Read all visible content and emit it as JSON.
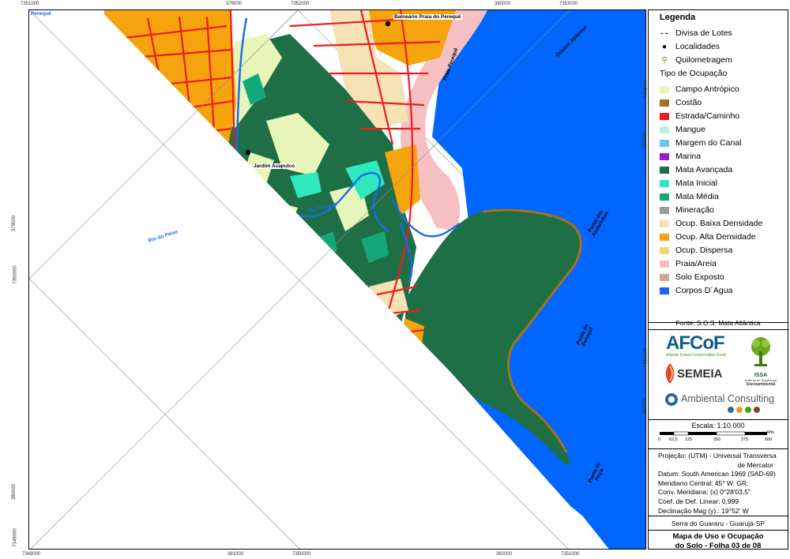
{
  "map": {
    "top_ticks": [
      "7351000",
      "379000",
      "7352000",
      "380000",
      "7353000"
    ],
    "bottom_ticks": [
      "7349000",
      "381000",
      "7350000",
      "382000",
      "7351000"
    ],
    "left_ticks": [
      "379000",
      "7350000",
      "380000",
      "7349000"
    ],
    "right_ticks": [
      "7352000",
      "381000",
      "7350000",
      "382000"
    ],
    "place_labels": {
      "pereque_corner": "Perequê",
      "balneario": "Balneário Praia do Perequê",
      "jardim_acapulco": "Jardim Acapulco",
      "rio_pereque": "Rio Perequê",
      "rio_do_peixe": "Rio do Peixe",
      "praia_pereque": "Praia Perequê",
      "oceano": "Oceano Atlântico",
      "ponta_andorinhas_1": "Ponta das",
      "ponta_andorinhas_2": "Andorinhas",
      "ponta_pereque_1": "Ponta do",
      "ponta_pereque_2": "Perequê",
      "ponta_poco_1": "Ponta do",
      "ponta_poco_2": "Poço"
    }
  },
  "legend": {
    "title": "Legenda",
    "symbols": [
      {
        "label": "Divisa de Lotes",
        "glyph": "- -"
      },
      {
        "label": "Localidades",
        "glyph": "●"
      },
      {
        "label": "Quilometragem",
        "glyph": "⚲"
      }
    ],
    "occupation_heading": "Tipo de Ocupação",
    "classes": [
      {
        "label": "Campo Antrópico",
        "color": "#e8f5b8"
      },
      {
        "label": "Costão",
        "color": "#a87018"
      },
      {
        "label": "Estrada/Caminho",
        "color": "#ee1c1c"
      },
      {
        "label": "Mangue",
        "color": "#b6f3e6"
      },
      {
        "label": "Margem do Canal",
        "color": "#66c8ee"
      },
      {
        "label": "Marina",
        "color": "#9a1ec8"
      },
      {
        "label": "Mata Avançada",
        "color": "#1e6e46"
      },
      {
        "label": "Mata Inicial",
        "color": "#2ee8c0"
      },
      {
        "label": "Mata Média",
        "color": "#14a878"
      },
      {
        "label": "Mineração",
        "color": "#9a9a9a"
      },
      {
        "label": "Ocup. Baixa Densidade",
        "color": "#f6e2b4"
      },
      {
        "label": "Ocup. Alta Densidade",
        "color": "#f5a40e"
      },
      {
        "label": "Ocup. Dispersa",
        "color": "#f6d476"
      },
      {
        "label": "Praia/Areia",
        "color": "#f6c0c2"
      },
      {
        "label": "Solo Exposto",
        "color": "#d4a890"
      },
      {
        "label": "Corpos D´Agua",
        "color": "#1a6ae8"
      }
    ],
    "source": "Fonte: S.O.S. Mata Atlântica"
  },
  "logos": {
    "afcof": "AFCoF",
    "afcof_sub": "Atlantic Forest Conservation Fund",
    "semeia": "SEMEIA",
    "issa": "ISSA",
    "issa_sub1": "Instituto de Segurança",
    "issa_sub2": "Socioambiental",
    "ambiental": "Ambiental Consulting"
  },
  "scale": {
    "label": "Escala: 1:10.000",
    "ticks": [
      "0",
      "62,5",
      "125",
      "250",
      "375",
      "500"
    ],
    "unit": "Mts"
  },
  "projection": [
    "Projeção: (UTM) - Universal Transversa",
    "de Mercator",
    "Datum: South American 1969 (SAD-69)",
    "Meridiano Central: 45° W. GR.",
    "Conv. Meridiana: (x) 0°28'03,5\"",
    "Coef. de Def. Linear: 0,999",
    "Declinação Mag (y).: 19°52' W"
  ],
  "location": "Serra do Guararu - Guarujá-SP",
  "map_title_line1": "Mapa de Uso e Ocupação",
  "map_title_line2": "do Solo - Folha 03 de 08",
  "colors": {
    "ocean": "#0066ff",
    "frame": "#000000",
    "grid": "#888888"
  }
}
